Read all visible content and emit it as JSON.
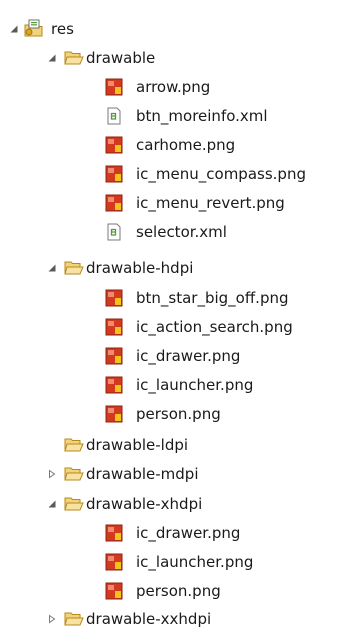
{
  "tree": {
    "root": {
      "label": "res",
      "icon": "resource-folder-icon",
      "expanded": true
    },
    "nodes": [
      {
        "label": "drawable",
        "type": "folder",
        "expanded": true,
        "children": [
          {
            "label": "arrow.png",
            "type": "png"
          },
          {
            "label": "btn_moreinfo.xml",
            "type": "xml"
          },
          {
            "label": "carhome.png",
            "type": "png"
          },
          {
            "label": "ic_menu_compass.png",
            "type": "png"
          },
          {
            "label": "ic_menu_revert.png",
            "type": "png"
          },
          {
            "label": "selector.xml",
            "type": "xml"
          }
        ]
      },
      {
        "label": "drawable-hdpi",
        "type": "folder",
        "expanded": true,
        "children": [
          {
            "label": "btn_star_big_off.png",
            "type": "png"
          },
          {
            "label": "ic_action_search.png",
            "type": "png"
          },
          {
            "label": "ic_drawer.png",
            "type": "png"
          },
          {
            "label": "ic_launcher.png",
            "type": "png"
          },
          {
            "label": "person.png",
            "type": "png"
          }
        ]
      },
      {
        "label": "drawable-ldpi",
        "type": "folder",
        "expanded": false,
        "empty": true,
        "children": []
      },
      {
        "label": "drawable-mdpi",
        "type": "folder",
        "expanded": false,
        "children": []
      },
      {
        "label": "drawable-xhdpi",
        "type": "folder",
        "expanded": true,
        "children": [
          {
            "label": "ic_drawer.png",
            "type": "png"
          },
          {
            "label": "ic_launcher.png",
            "type": "png"
          },
          {
            "label": "person.png",
            "type": "png"
          }
        ]
      },
      {
        "label": "drawable-xxhdpi",
        "type": "folder",
        "expanded": false,
        "children": []
      }
    ]
  },
  "colors": {
    "folder_fill": "#f2d27a",
    "folder_stroke": "#b88a1e",
    "png_red": "#d2391e",
    "png_yellow": "#f5c21b",
    "xml_green": "#4f9a3a",
    "twisty": "#5a5a5a"
  }
}
